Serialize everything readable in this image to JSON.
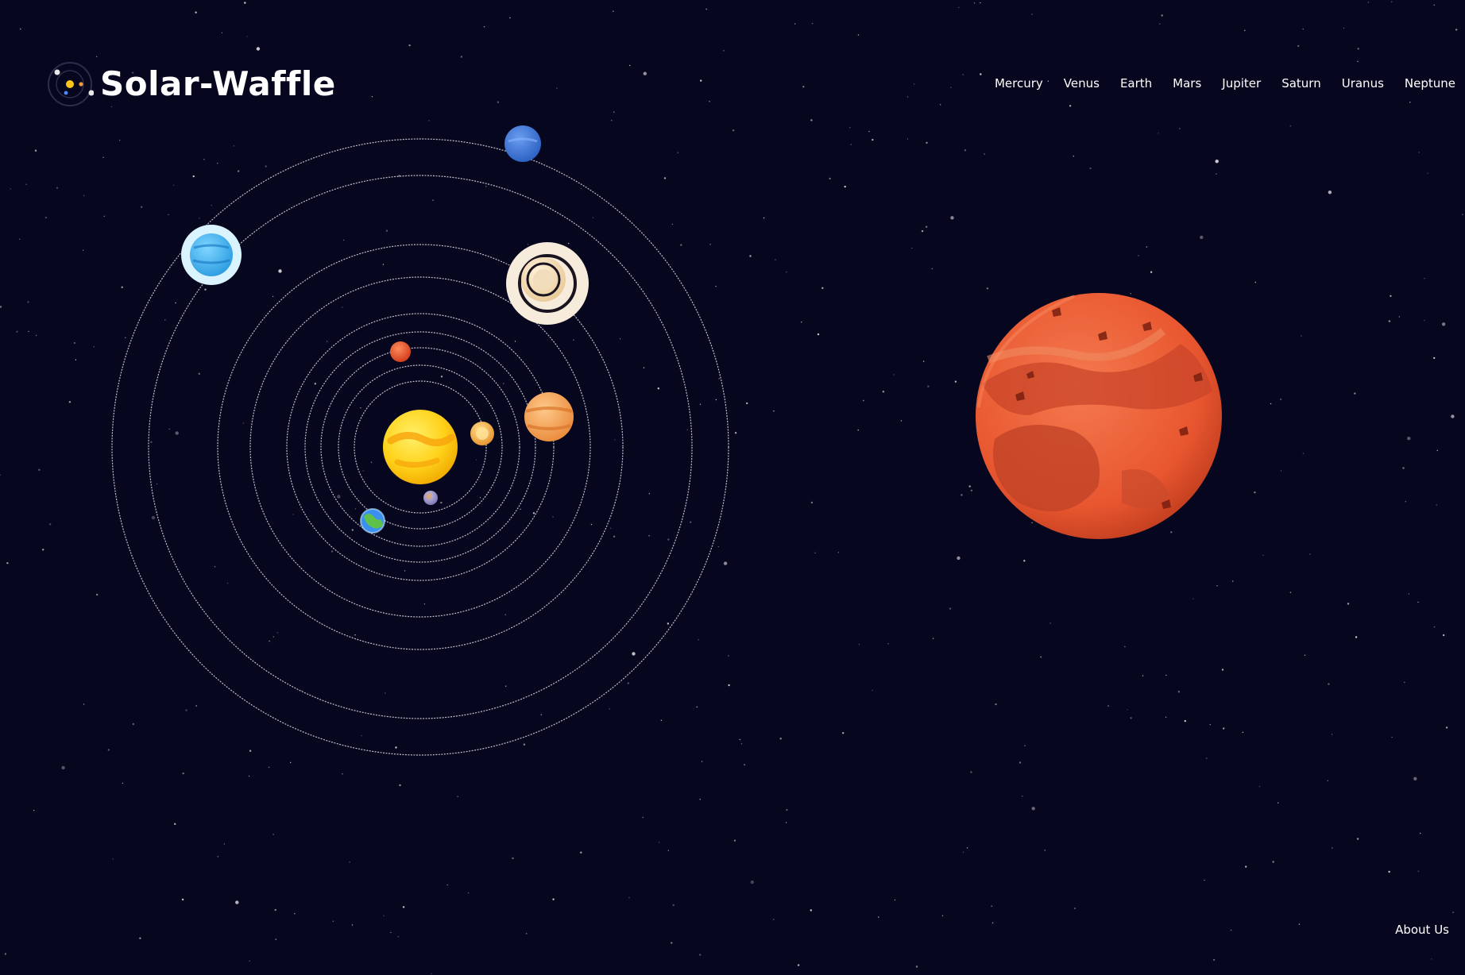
{
  "brand": {
    "name": "Solar-Waffle"
  },
  "nav": {
    "items": [
      {
        "label": "Mercury"
      },
      {
        "label": "Venus"
      },
      {
        "label": "Earth"
      },
      {
        "label": "Mars"
      },
      {
        "label": "Jupiter"
      },
      {
        "label": "Saturn"
      },
      {
        "label": "Uranus"
      },
      {
        "label": "Neptune"
      }
    ]
  },
  "footer": {
    "about_label": "About Us"
  },
  "featured_planet": {
    "name": "mars-3d-model",
    "color": "#e8562f"
  },
  "colors": {
    "background": "#07061f",
    "orbit": "#ffffff",
    "sun": "#ffd21a"
  }
}
